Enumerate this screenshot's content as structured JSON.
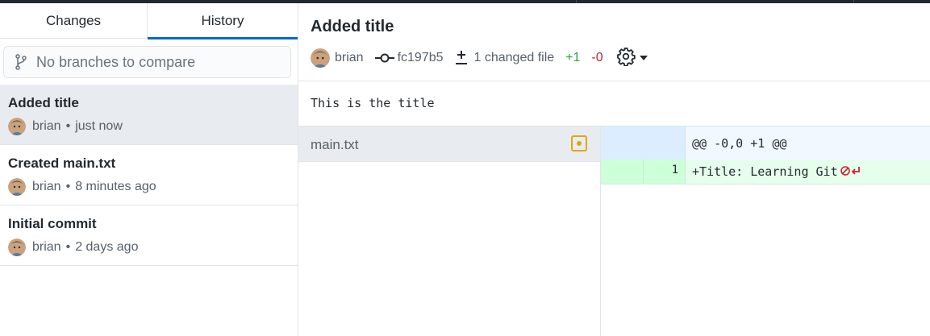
{
  "tabs": {
    "changes": "Changes",
    "history": "History"
  },
  "compare": {
    "placeholder": "No branches to compare"
  },
  "commits": [
    {
      "title": "Added title",
      "author": "brian",
      "time": "just now",
      "selected": true
    },
    {
      "title": "Created main.txt",
      "author": "brian",
      "time": "8 minutes ago",
      "selected": false
    },
    {
      "title": "Initial commit",
      "author": "brian",
      "time": "2 days ago",
      "selected": false
    }
  ],
  "commit_detail": {
    "title": "Added title",
    "author": "brian",
    "sha": "fc197b5",
    "changed_files": "1 changed file",
    "additions": "+1",
    "deletions": "-0",
    "description": "This is the title"
  },
  "files": [
    {
      "name": "main.txt",
      "status": "modified"
    }
  ],
  "diff": {
    "hunk_header": "@@ -0,0 +1 @@",
    "lines": [
      {
        "new_line_number": "1",
        "text": "+Title: Learning Git",
        "no_newline": true
      }
    ]
  },
  "colors": {
    "accent": "#0366d6",
    "added": "#28a745",
    "deleted": "#cb2431",
    "modified": "#dbab09"
  },
  "icons": [
    "git-compare-icon",
    "commit-icon",
    "diff-icon",
    "gear-icon",
    "chevron-down-icon",
    "no-newline-icon",
    "file-modified-icon"
  ]
}
